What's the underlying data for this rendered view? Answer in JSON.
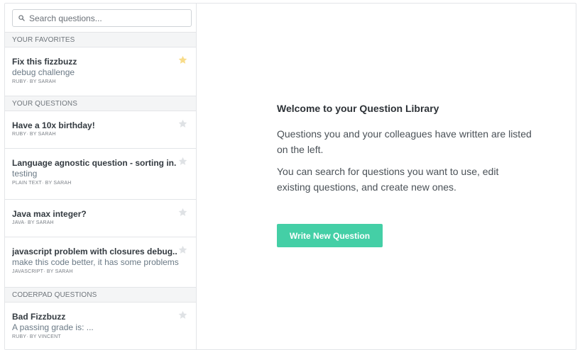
{
  "search": {
    "placeholder": "Search questions..."
  },
  "sections": {
    "favorites": {
      "header": "YOUR FAVORITES",
      "items": [
        {
          "title": "Fix this fizzbuzz",
          "description": "debug challenge",
          "meta": "RUBY· BY SARAH",
          "favorited": true
        }
      ]
    },
    "yours": {
      "header": "YOUR QUESTIONS",
      "items": [
        {
          "title": "Have a 10x birthday!",
          "description": "",
          "meta": "RUBY· BY SARAH",
          "favorited": false
        },
        {
          "title": "Language agnostic question - sorting in...",
          "description": "testing",
          "meta": "PLAIN TEXT· BY SARAH",
          "favorited": false
        },
        {
          "title": "Java max integer?",
          "description": "",
          "meta": "JAVA· BY SARAH",
          "favorited": false
        },
        {
          "title": "javascript problem with closures debug...",
          "description": "make this code better, it has some problems",
          "meta": "JAVASCRIPT· BY SARAH",
          "favorited": false
        }
      ]
    },
    "coderpad": {
      "header": "CODERPAD QUESTIONS",
      "items": [
        {
          "title": "Bad Fizzbuzz",
          "description": "A passing grade is: ...",
          "meta": "RUBY· BY VINCENT",
          "favorited": false
        }
      ]
    }
  },
  "welcome": {
    "heading": "Welcome to your Question Library",
    "paragraph1": "Questions you and your colleagues have written are listed on the left.",
    "paragraph2": "You can search for questions you want to use, edit existing questions, and create new ones.",
    "cta_label": "Write New Question"
  },
  "colors": {
    "accent": "#44cfa6",
    "star_favorited": "#f8dc8a",
    "star_default": "#dfe2e5"
  },
  "icons": {
    "search": "search-icon",
    "star": "star-icon"
  }
}
